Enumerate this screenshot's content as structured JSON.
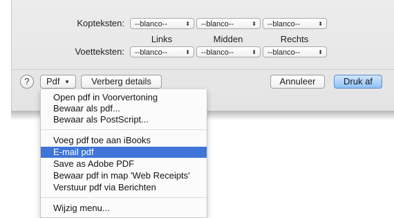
{
  "headers_footers": {
    "header_label": "Kopteksten:",
    "footer_label": "Voetteksten:",
    "header_popups": [
      "--blanco--",
      "--blanco--",
      "--blanco--"
    ],
    "footer_popups": [
      "--blanco--",
      "--blanco--",
      "--blanco--"
    ],
    "columns": [
      "Links",
      "Midden",
      "Rechts"
    ]
  },
  "buttons": {
    "help": "?",
    "pdf": "Pdf",
    "pdf_arrow": "▼",
    "details": "Verberg details",
    "cancel": "Annuleer",
    "print": "Druk af"
  },
  "pdf_menu": {
    "items": [
      "Open pdf in Voorvertoning",
      "Bewaar als pdf...",
      "Bewaar als PostScript...",
      "Voeg pdf toe aan iBooks",
      "E-mail pdf",
      "Save as Adobe PDF",
      "Bewaar pdf in map 'Web Receipts'",
      "Verstuur pdf via Berichten",
      "Wijzig menu..."
    ],
    "highlighted_index": 4
  },
  "colors": {
    "highlight": "#3f74d9",
    "default_button": "#8ec0f4"
  }
}
